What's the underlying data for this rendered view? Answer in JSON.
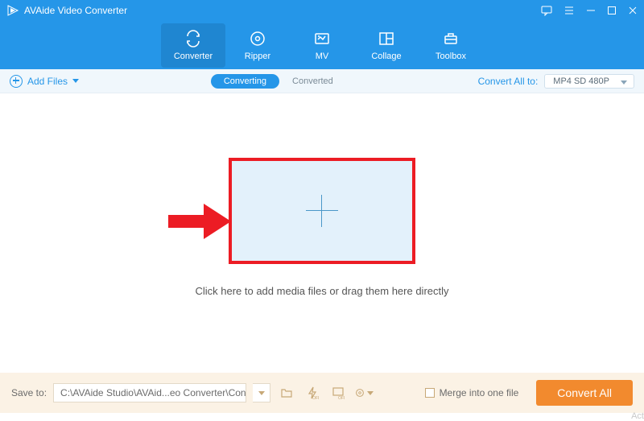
{
  "titlebar": {
    "app_name": "AVAide Video Converter"
  },
  "tabs": {
    "converter": "Converter",
    "ripper": "Ripper",
    "mv": "MV",
    "collage": "Collage",
    "toolbox": "Toolbox"
  },
  "toolbar": {
    "add_files": "Add Files",
    "sub_tabs": {
      "converting": "Converting",
      "converted": "Converted"
    },
    "convert_all_to_label": "Convert All to:",
    "format_value": "MP4 SD 480P"
  },
  "main": {
    "hint": "Click here to add media files or drag them here directly"
  },
  "bottom": {
    "save_to_label": "Save to:",
    "path": "C:\\AVAide Studio\\AVAid...eo Converter\\Converted",
    "merge_label": "Merge into one file",
    "convert_all_btn": "Convert All"
  },
  "watermark": "Act"
}
